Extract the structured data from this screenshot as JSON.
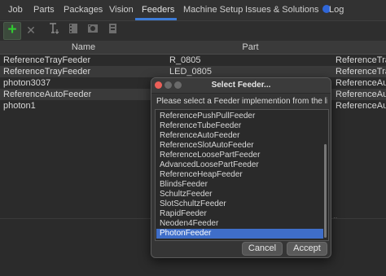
{
  "tabs": [
    {
      "label": "Job"
    },
    {
      "label": "Parts"
    },
    {
      "label": "Packages"
    },
    {
      "label": "Vision"
    },
    {
      "label": "Feeders"
    },
    {
      "label": "Machine Setup"
    },
    {
      "label": "Issues & Solutions"
    },
    {
      "label": "Log"
    }
  ],
  "active_tab": "Feeders",
  "toolbar": {
    "add_icon": "plus-icon",
    "remove_icon": "close-icon"
  },
  "table": {
    "headers": [
      "Name",
      "Part"
    ],
    "rows": [
      {
        "name": "ReferenceTrayFeeder",
        "part": "R_0805",
        "type": "ReferenceTrayF"
      },
      {
        "name": "ReferenceTrayFeeder",
        "part": "LED_0805",
        "type": "ReferenceTrayF"
      },
      {
        "name": "photon3037",
        "part": "",
        "type": "ReferenceAutoF"
      },
      {
        "name": "ReferenceAutoFeeder",
        "part": "",
        "type": "ReferenceAutoF"
      },
      {
        "name": "photon1",
        "part": "",
        "type": "ReferenceAutoF"
      }
    ]
  },
  "dialog": {
    "title": "Select Feeder...",
    "message": "Please select a Feeder implemention from the list ...",
    "items": [
      "ReferencePushPullFeeder",
      "ReferenceTubeFeeder",
      "ReferenceAutoFeeder",
      "ReferenceSlotAutoFeeder",
      "ReferenceLoosePartFeeder",
      "AdvancedLoosePartFeeder",
      "ReferenceHeapFeeder",
      "BlindsFeeder",
      "SchultzFeeder",
      "SlotSchultzFeeder",
      "RapidFeeder",
      "Neoden4Feeder",
      "PhotonFeeder"
    ],
    "selected": "PhotonFeeder",
    "cancel_label": "Cancel",
    "accept_label": "Accept"
  },
  "colors": {
    "accent": "#3d7bd6",
    "selection": "#3f6ec9",
    "add": "#31c931"
  }
}
